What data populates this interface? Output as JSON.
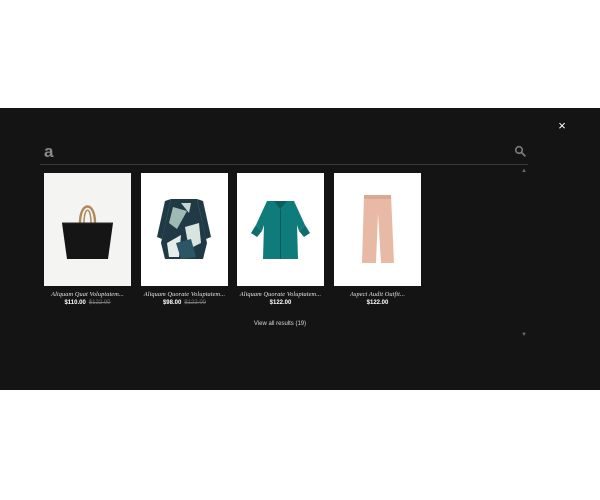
{
  "search": {
    "value": "a"
  },
  "close_label": "×",
  "products": [
    {
      "name": "Aliquam Quat Voluptatem...",
      "price": "$110.00",
      "old_price": "$122.00",
      "image": "black-tote-bag"
    },
    {
      "name": "Aliquam Quorate Voluptatem...",
      "price": "$98.00",
      "old_price": "$122.00",
      "image": "print-tunic"
    },
    {
      "name": "Aliquam Quorate Voluptatem...",
      "price": "$122.00",
      "old_price": "",
      "image": "teal-blouse"
    },
    {
      "name": "Aspect Audit Outfit...",
      "price": "$122.00",
      "old_price": "",
      "image": "blush-trousers"
    }
  ],
  "view_all": "View all results (19)",
  "colors": {
    "overlay": "#141414",
    "text": "#ffffff",
    "muted": "#777777"
  }
}
